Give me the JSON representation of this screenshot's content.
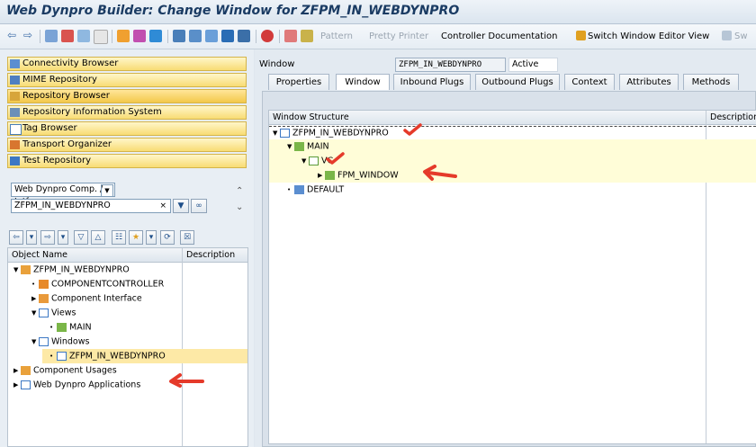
{
  "window_title": "Web Dynpro Builder: Change Window for ZFPM_IN_WEBDYNPRO",
  "toolbar": {
    "pattern": "Pattern",
    "pretty_printer": "Pretty Printer",
    "controller_documentation": "Controller Documentation",
    "switch_window_editor_view": "Switch Window Editor View",
    "sw_cut": "Sw"
  },
  "nav": [
    {
      "label": "Connectivity Browser"
    },
    {
      "label": "MIME Repository"
    },
    {
      "label": "Repository Browser"
    },
    {
      "label": "Repository Information System"
    },
    {
      "label": "Tag Browser"
    },
    {
      "label": "Transport Organizer"
    },
    {
      "label": "Test Repository"
    }
  ],
  "object_type": {
    "value": "Web Dynpro Comp. / Intf."
  },
  "object_name": {
    "value": "ZFPM_IN_WEBDYNPRO"
  },
  "object_tree": {
    "columns": {
      "name": "Object Name",
      "description": "Description"
    },
    "rows": [
      {
        "label": "ZFPM_IN_WEBDYNPRO"
      },
      {
        "label": "COMPONENTCONTROLLER"
      },
      {
        "label": "Component Interface"
      },
      {
        "label": "Views"
      },
      {
        "label": "MAIN"
      },
      {
        "label": "Windows"
      },
      {
        "label": "ZFPM_IN_WEBDYNPRO"
      },
      {
        "label": "Component Usages"
      },
      {
        "label": "Web Dynpro Applications"
      }
    ]
  },
  "window_header": {
    "label": "Window",
    "name": "ZFPM_IN_WEBDYNPRO",
    "status": "Active"
  },
  "tabs": [
    "Properties",
    "Window",
    "Inbound Plugs",
    "Outbound Plugs",
    "Context",
    "Attributes",
    "Methods"
  ],
  "window_structure": {
    "columns": {
      "name": "Window Structure",
      "description": "Description"
    },
    "rows": [
      {
        "label": "ZFPM_IN_WEBDYNPRO"
      },
      {
        "label": "MAIN"
      },
      {
        "label": "VC"
      },
      {
        "label": "FPM_WINDOW"
      },
      {
        "label": "DEFAULT"
      }
    ]
  },
  "colors": {
    "annotation": "#e53a2a",
    "nav_yellow": "#f8dc74",
    "selection": "#fde9a6"
  }
}
